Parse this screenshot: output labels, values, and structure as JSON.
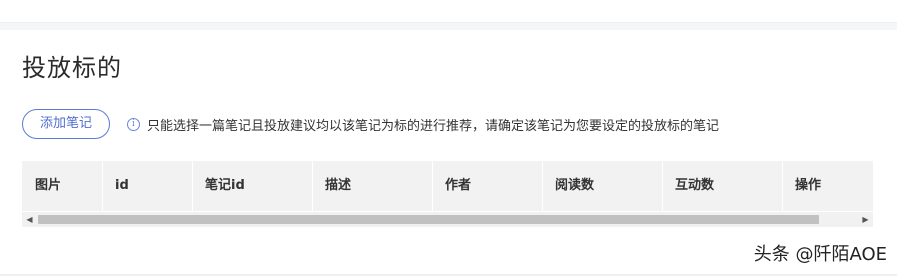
{
  "page": {
    "title": "投放标的"
  },
  "actions": {
    "add_note_label": "添加笔记"
  },
  "hint": {
    "icon": "info-icon",
    "text": "只能选择一篇笔记且投放建议均以该笔记为标的进行推荐，请确定该笔记为您要设定的投放标的笔记"
  },
  "table": {
    "columns": [
      "图片",
      "id",
      "笔记id",
      "描述",
      "作者",
      "阅读数",
      "互动数",
      "操作"
    ],
    "rows": []
  },
  "watermark": {
    "text": "头条 @阡陌AOE"
  },
  "colors": {
    "accent": "#4f6fd1",
    "header_bg": "#f2f2f2",
    "page_bg": "#f5f6f8"
  }
}
